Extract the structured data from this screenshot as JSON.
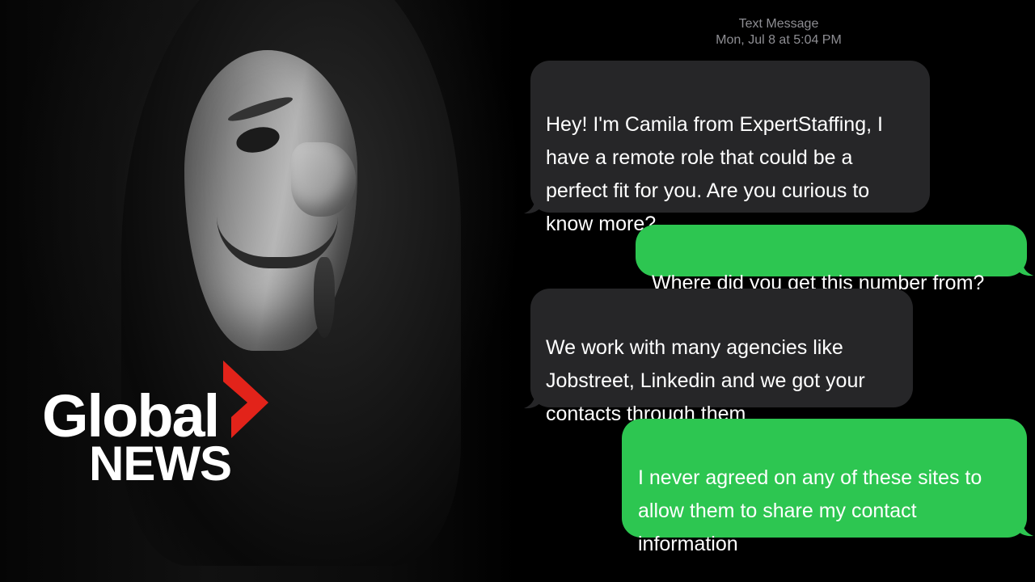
{
  "header": {
    "service": "Text Message",
    "timestamp": "Mon, Jul 8 at 5:04 PM"
  },
  "messages": [
    {
      "direction": "incoming",
      "text": "Hey! I'm Camila from ExpertStaffing, I\nhave a remote role that  could be a\nperfect fit for you. Are you curious to\nknow more?"
    },
    {
      "direction": "outgoing",
      "text": "Where did you get this number from?"
    },
    {
      "direction": "incoming",
      "text": "We work with many  agencies like\nJobstreet, Linkedin and we got your\ncontacts through them"
    },
    {
      "direction": "outgoing",
      "text": "I never agreed on any of these sites to\nallow them to share my contact\ninformation"
    }
  ],
  "logo": {
    "line1": "Global",
    "line2": "NEWS"
  },
  "colors": {
    "incoming_bubble": "#262628",
    "outgoing_bubble": "#2dc651",
    "logo_accent": "#e2231a",
    "header_text": "#8e8e93"
  }
}
